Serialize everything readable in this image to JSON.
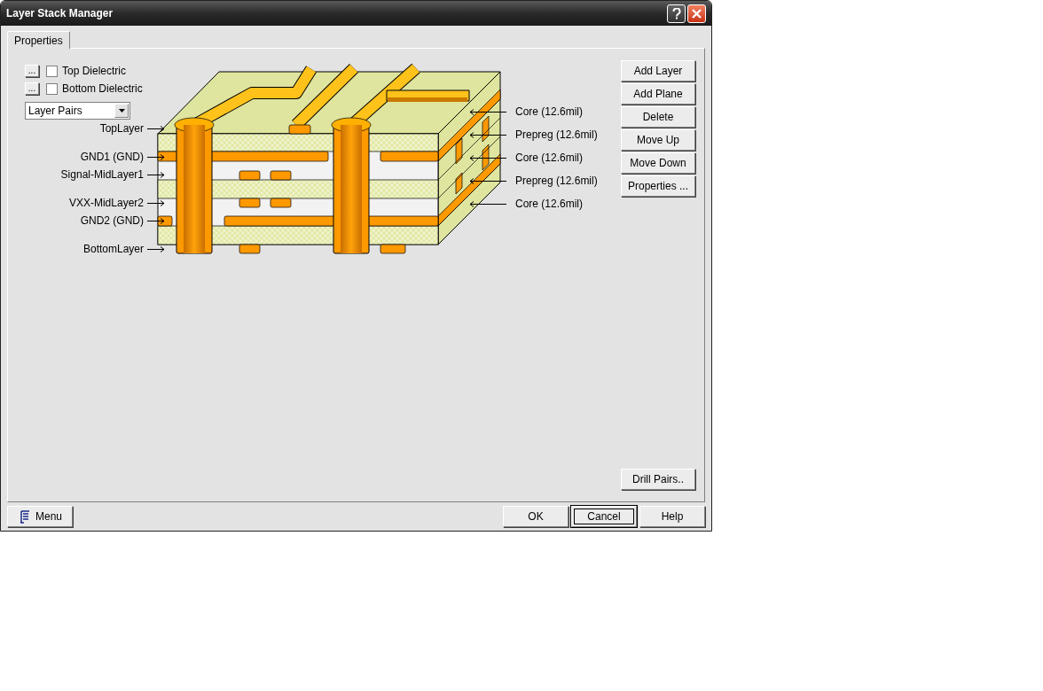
{
  "window": {
    "title": "Layer Stack Manager"
  },
  "tabs": [
    {
      "label": "Properties",
      "selected": true
    }
  ],
  "dielectrics": [
    {
      "button": "...",
      "label": "Top Dielectric",
      "checked": false
    },
    {
      "button": "...",
      "label": "Bottom Dielectric",
      "checked": false
    }
  ],
  "view_dropdown": {
    "value": "Layer Pairs"
  },
  "layer_labels": [
    "TopLayer",
    "GND1 (GND)",
    "Signal-MidLayer1",
    "VXX-MidLayer2",
    "GND2 (GND)",
    "BottomLayer"
  ],
  "dielectric_labels": [
    "Core (12.6mil)",
    "Prepreg (12.6mil)",
    "Core (12.6mil)",
    "Prepreg (12.6mil)",
    "Core (12.6mil)"
  ],
  "side_buttons": [
    "Add Layer",
    "Add Plane",
    "Delete",
    "Move Up",
    "Move Down",
    "Properties ..."
  ],
  "drill_pairs_button": "Drill Pairs..",
  "menu_button": "Menu",
  "footer_buttons": [
    {
      "label": "OK",
      "focused": false
    },
    {
      "label": "Cancel",
      "focused": true
    },
    {
      "label": "Help",
      "focused": false
    }
  ]
}
